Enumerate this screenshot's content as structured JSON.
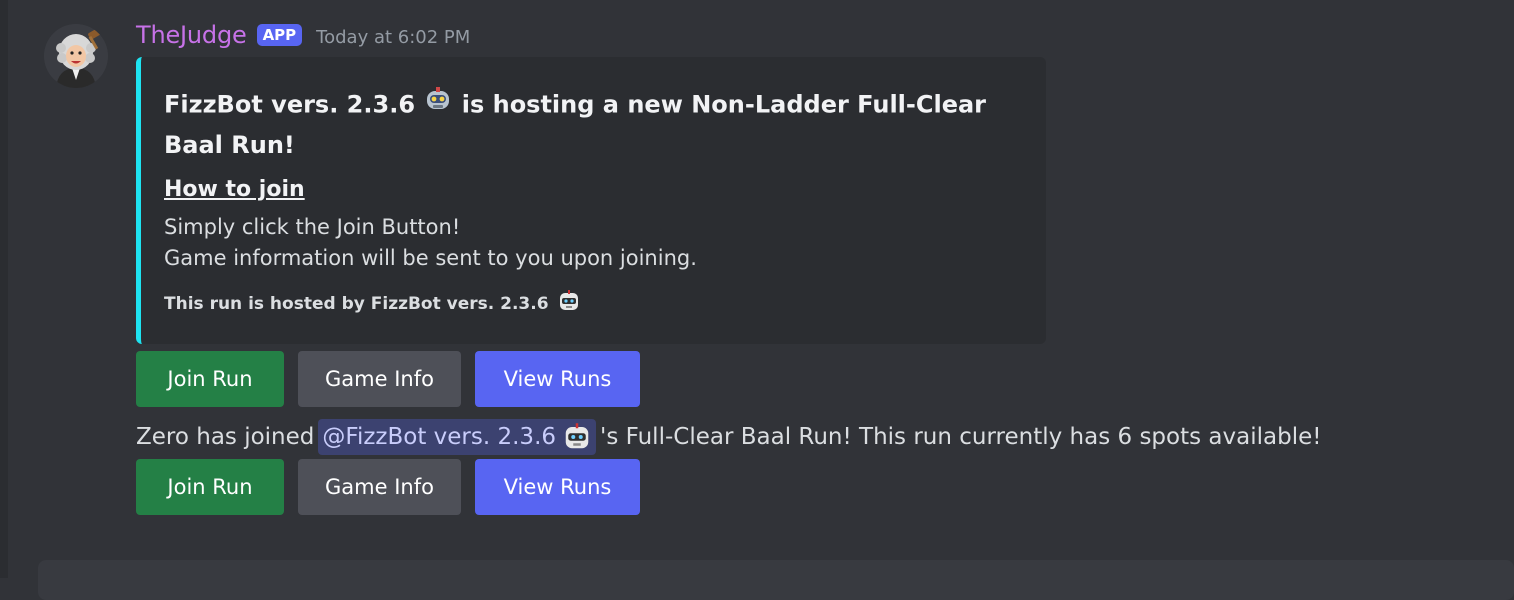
{
  "message": {
    "username": "TheJudge",
    "badge": "APP",
    "timestamp": "Today at 6:02 PM",
    "avatar_icon": "judge-gavel-avatar"
  },
  "embed": {
    "accent_color": "#1ee3f1",
    "title_prefix": "FizzBot vers. 2.3.6",
    "title_suffix": "is hosting a new Non-Ladder Full-Clear Baal Run!",
    "title_emoji": "robot-emoji",
    "field_name": "How to join",
    "field_line1": "Simply click the Join Button!",
    "field_line2": "Game information will be sent to you upon joining.",
    "footer_text": "This run is hosted by FizzBot vers. 2.3.6",
    "footer_emoji": "robot-face-emoji"
  },
  "buttons_first": {
    "join": "Join Run",
    "info": "Game Info",
    "view": "View Runs"
  },
  "notice": {
    "before": "Zero has joined",
    "mention": "@FizzBot vers. 2.3.6",
    "after": "'s Full-Clear Baal Run! This run currently has 6 spots available!"
  },
  "buttons_second": {
    "join": "Join Run",
    "info": "Game Info",
    "view": "View Runs"
  },
  "colors": {
    "background": "#313338",
    "username": "#c772e8",
    "badge": "#5865f2",
    "success": "#248046",
    "secondary": "#4e5058",
    "primary": "#5865f2",
    "mention_bg": "#3c4270"
  }
}
